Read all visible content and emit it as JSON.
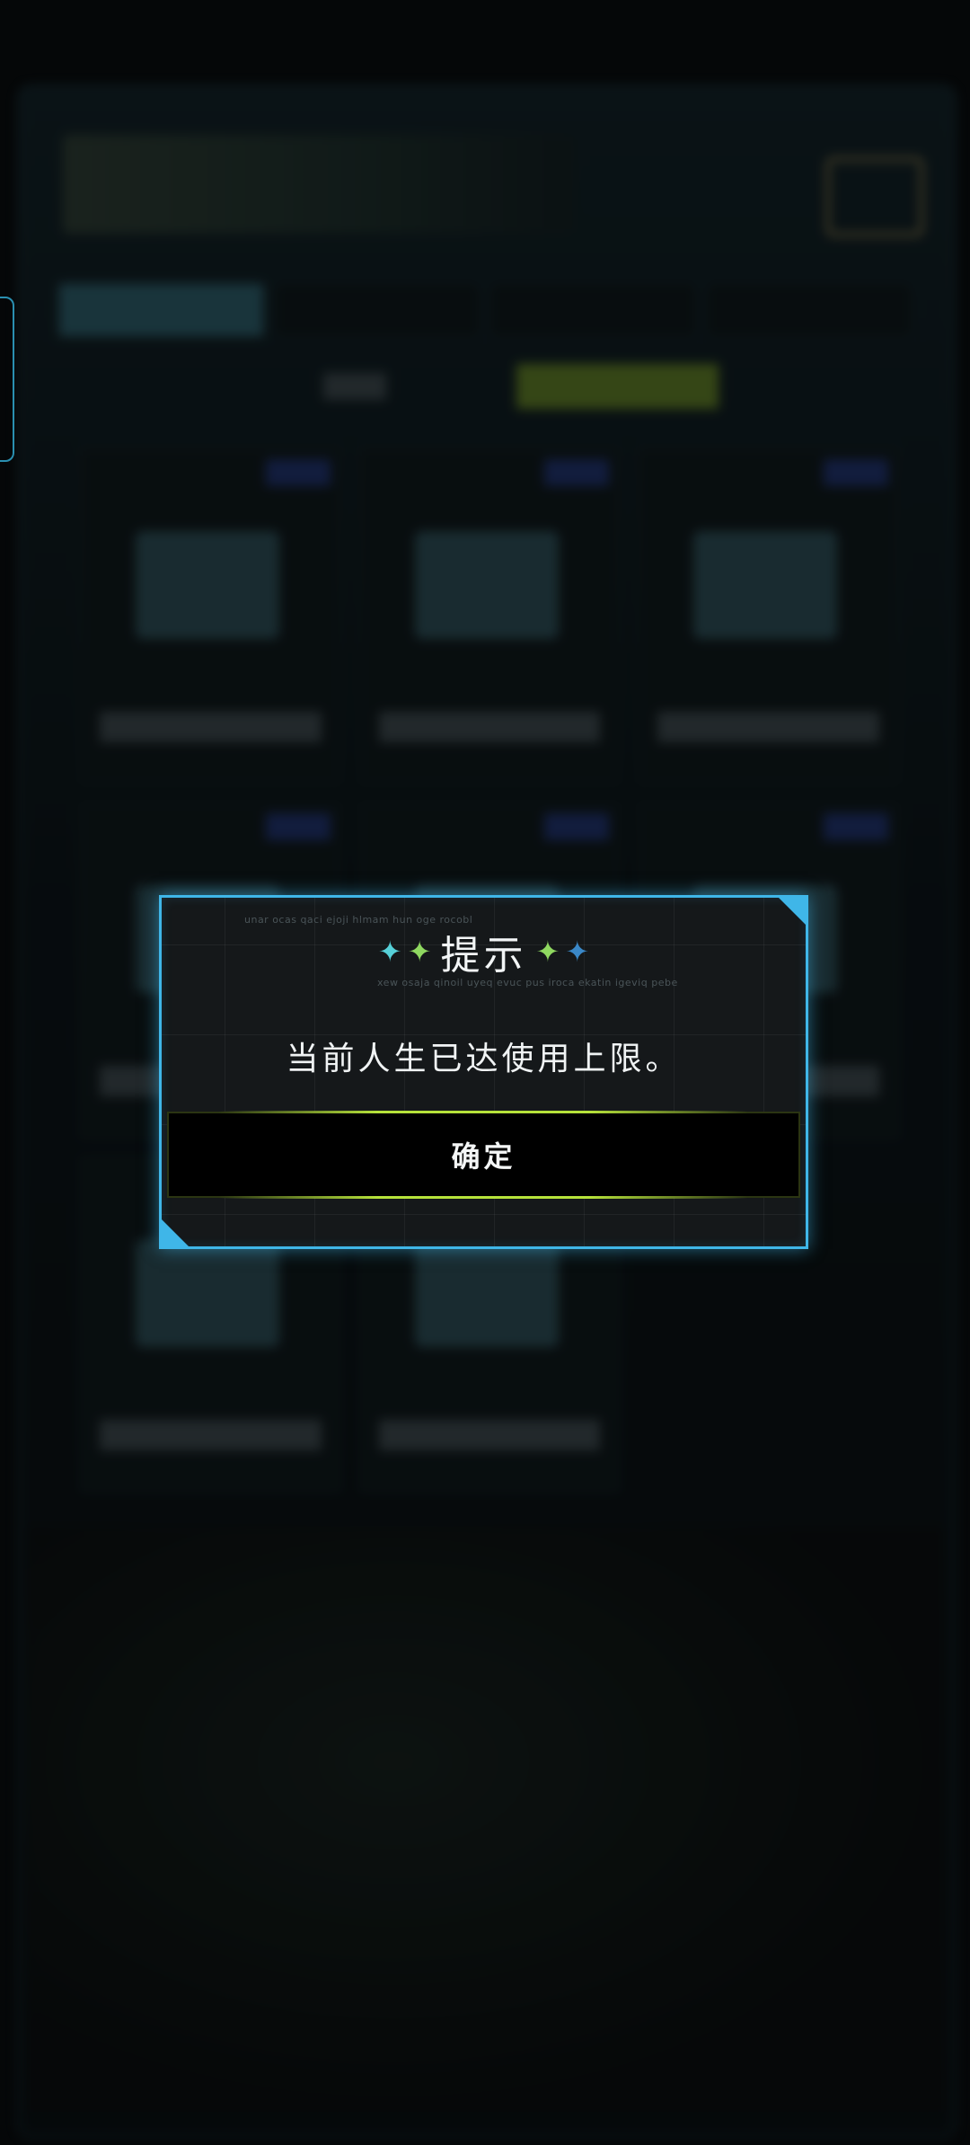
{
  "dialog": {
    "title": "提示",
    "message": "当前人生已达使用上限。",
    "confirm_label": "确定",
    "decor_text_top": "unar ocas qaci ejoji hlmam hun oge rocobl",
    "decor_text_bottom": "xew osaja qinoil uyeq evuc pus iroca ekatin igeviq pebe",
    "accent_color": "#3fb6e8",
    "button_glow_color": "#b6e23a",
    "icons": [
      "sparkle-teal-icon",
      "sparkle-green-icon",
      "sparkle-green-icon",
      "sparkle-blue-icon"
    ]
  }
}
